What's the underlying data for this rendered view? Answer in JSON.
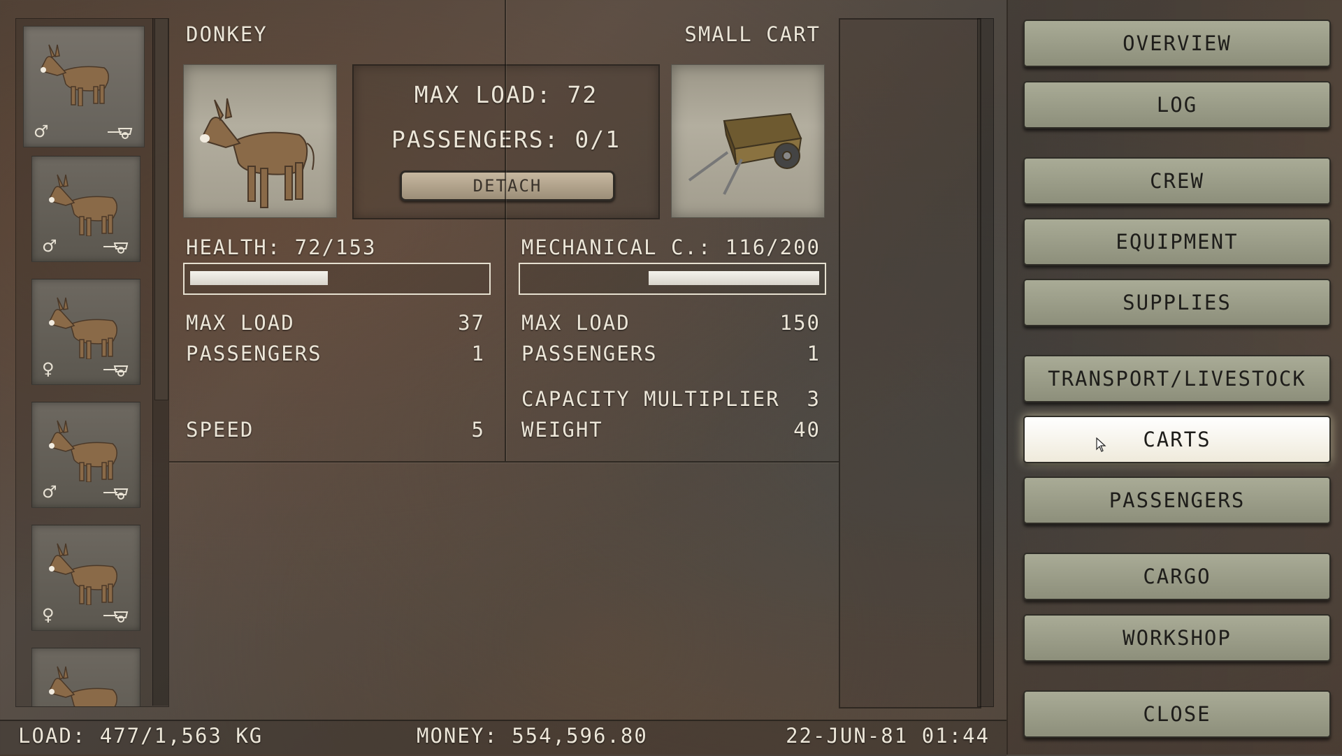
{
  "animal": {
    "name": "Donkey",
    "health_text": "HEALTH: 72/153",
    "health_fraction": 0.47,
    "stats": [
      {
        "label": "MAX LOAD",
        "value": "37"
      },
      {
        "label": "PASSENGERS",
        "value": "1"
      },
      {
        "label": "SPEED",
        "value": "5"
      }
    ]
  },
  "cart": {
    "name": "Small Cart",
    "condition_text": "MECHANICAL C.: 116/200",
    "condition_fraction": 0.58,
    "stats": [
      {
        "label": "MAX LOAD",
        "value": "150"
      },
      {
        "label": "PASSENGERS",
        "value": "1"
      },
      {
        "label": "CAPACITY MULTIPLIER",
        "value": "3"
      },
      {
        "label": "WEIGHT",
        "value": "40"
      }
    ]
  },
  "summary": {
    "max_load": "MAX LOAD: 72",
    "passengers": "PASSENGERS: 0/1",
    "detach_label": "DETACH"
  },
  "animal_list": [
    {
      "sex": "♂",
      "sex_name": "male",
      "has_cart": true,
      "selected": true
    },
    {
      "sex": "♂",
      "sex_name": "male",
      "has_cart": true,
      "selected": false
    },
    {
      "sex": "♀",
      "sex_name": "female",
      "has_cart": true,
      "selected": false
    },
    {
      "sex": "♂",
      "sex_name": "male",
      "has_cart": true,
      "selected": false
    },
    {
      "sex": "♀",
      "sex_name": "female",
      "has_cart": true,
      "selected": false
    },
    {
      "sex": "",
      "sex_name": "",
      "has_cart": false,
      "selected": false
    }
  ],
  "menu": {
    "overview": "OVERVIEW",
    "log": "LOG",
    "crew": "CREW",
    "equipment": "EQUIPMENT",
    "supplies": "SUPPLIES",
    "transport": "TRANSPORT/LIVESTOCK",
    "carts": "CARTS",
    "passengers": "PASSENGERS",
    "cargo": "CARGO",
    "workshop": "WORKSHOP",
    "close": "CLOSE",
    "active": "carts"
  },
  "status": {
    "load": "LOAD: 477/1,563 KG",
    "money": "MONEY: 554,596.80",
    "datetime": "22-JUN-81 01:44"
  },
  "colors": {
    "bar_fill": "#f1efe8",
    "active_button": "#fffaf0",
    "menu_button": "#9c9e89"
  }
}
